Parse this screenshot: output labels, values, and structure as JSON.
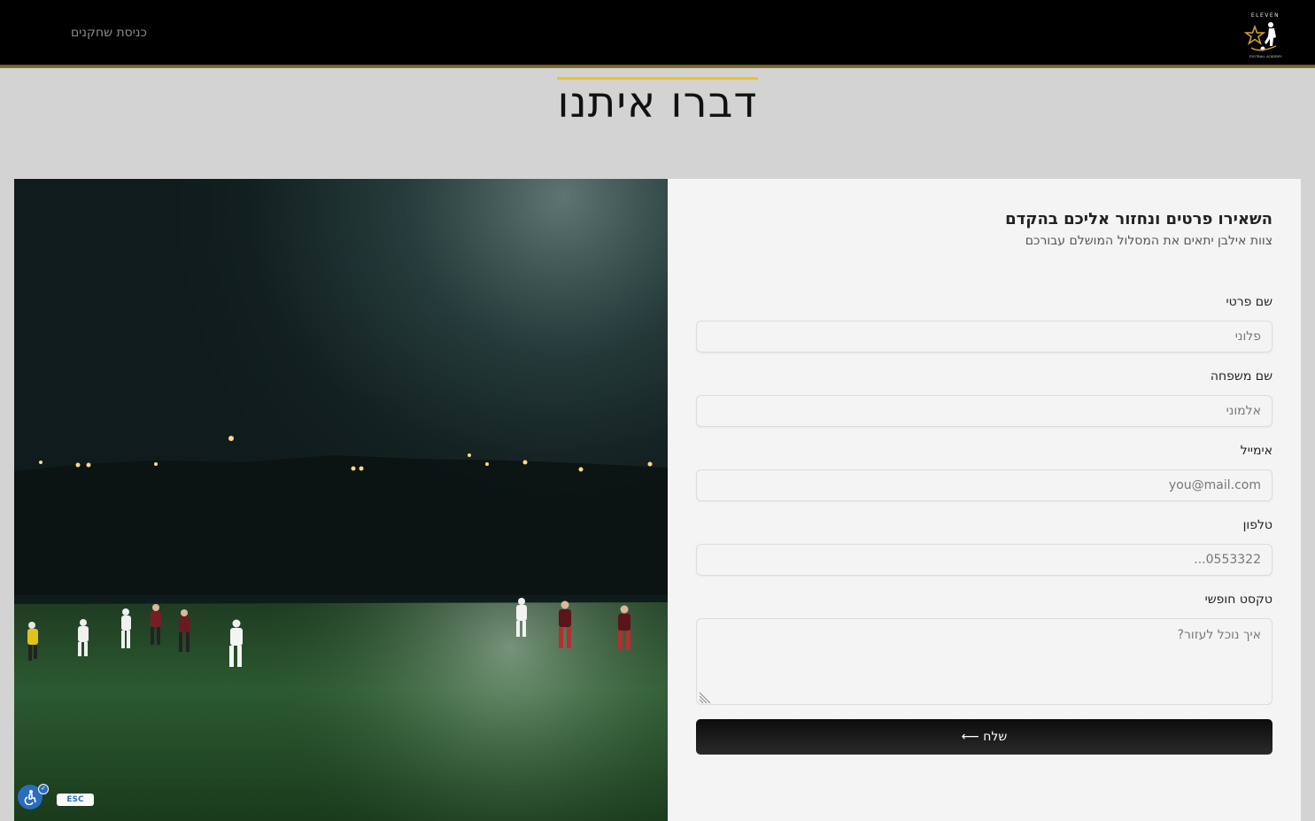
{
  "header": {
    "players_link": "כניסת שחקנים",
    "logo_icon": "eleven-football-academy-logo",
    "logo_text": "ELEVEN FOOTBALL ACADEMY"
  },
  "page": {
    "title": "דברו איתנו"
  },
  "form": {
    "heading": "השאירו פרטים ונחזור אליכם בהקדם",
    "subheading": "צוות אילבן יתאים את המסלול המושלם עבורכם",
    "first_name": {
      "label": "שם פרטי",
      "placeholder": "פלוני"
    },
    "last_name": {
      "label": "שם משפחה",
      "placeholder": "אלמוני"
    },
    "email": {
      "label": "אימייל",
      "placeholder": "you@mail.com"
    },
    "phone": {
      "label": "טלפון",
      "placeholder": "0553322..."
    },
    "message": {
      "label": "טקסט חופשי",
      "placeholder": "איך נוכל לעזור?"
    },
    "submit_label": "שלח ⟵"
  },
  "image": {
    "icon": "night-football-field-photo"
  },
  "accessibility": {
    "icon": "accessibility-icon",
    "esc_label": "ESC"
  },
  "colors": {
    "accent": "#f2c511",
    "header_bg": "#000000",
    "page_bg": "#d3d3d3",
    "card_bg": "#f4f4f4",
    "button_bg": "#111111",
    "a11y_blue": "#2a6dbf"
  }
}
